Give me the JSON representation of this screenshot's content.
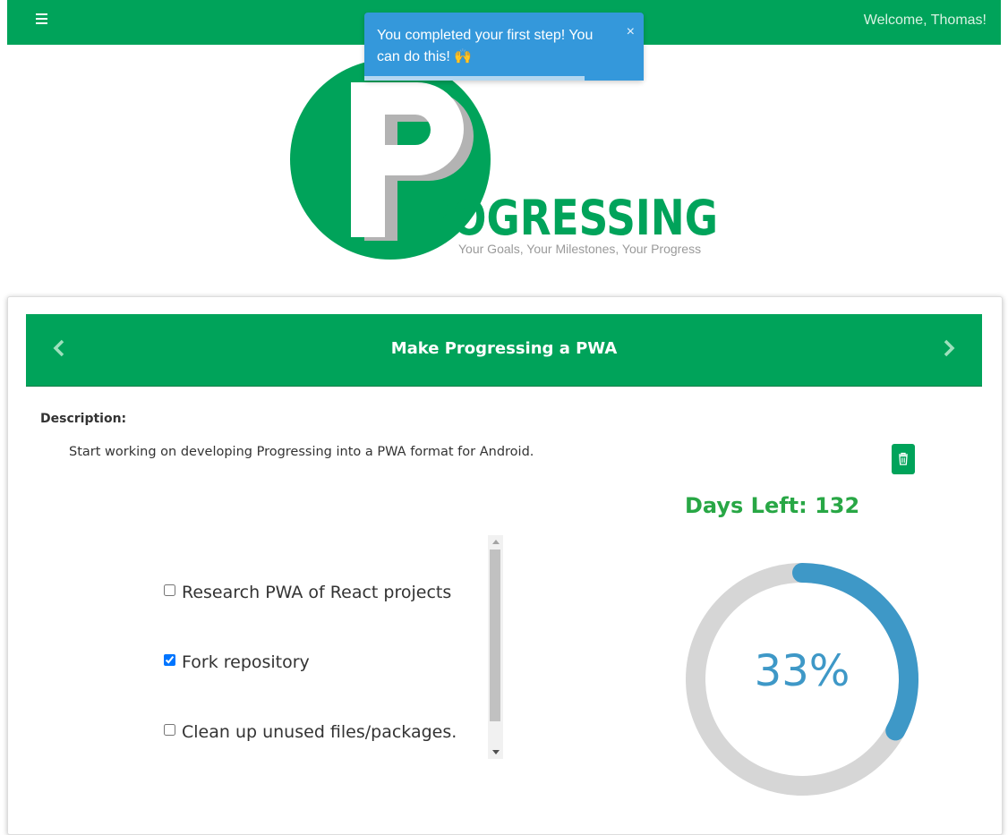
{
  "header": {
    "welcome_text": "Welcome, Thomas!",
    "menu_icon": "hamburger-menu-icon",
    "brand_color": "#00a35a"
  },
  "toast": {
    "message": "You completed your first step! You can do this! 🙌",
    "close_glyph": "×",
    "progress": 0.79,
    "color": "#3498db"
  },
  "logo": {
    "wordmark": "ROGRESSING",
    "tagline": "Your Goals, Your Milestones, Your Progress"
  },
  "goal": {
    "title": "Make Progressing a PWA",
    "prev_icon": "chevron-left-icon",
    "next_icon": "chevron-right-icon",
    "description_label": "Description:",
    "description": "Start working on developing Progressing into a PWA format for Android.",
    "delete_icon": "trash-icon",
    "days_left_text": "Days Left: 132",
    "milestones": [
      {
        "label": "Research PWA of React projects",
        "checked": false
      },
      {
        "label": "Fork repository",
        "checked": true
      },
      {
        "label": "Clean up unused files/packages.",
        "checked": false
      }
    ],
    "progress_percent": 33,
    "progress_label": "33%",
    "progress_color": "#3e98c7",
    "track_color": "#d6d6d6"
  }
}
